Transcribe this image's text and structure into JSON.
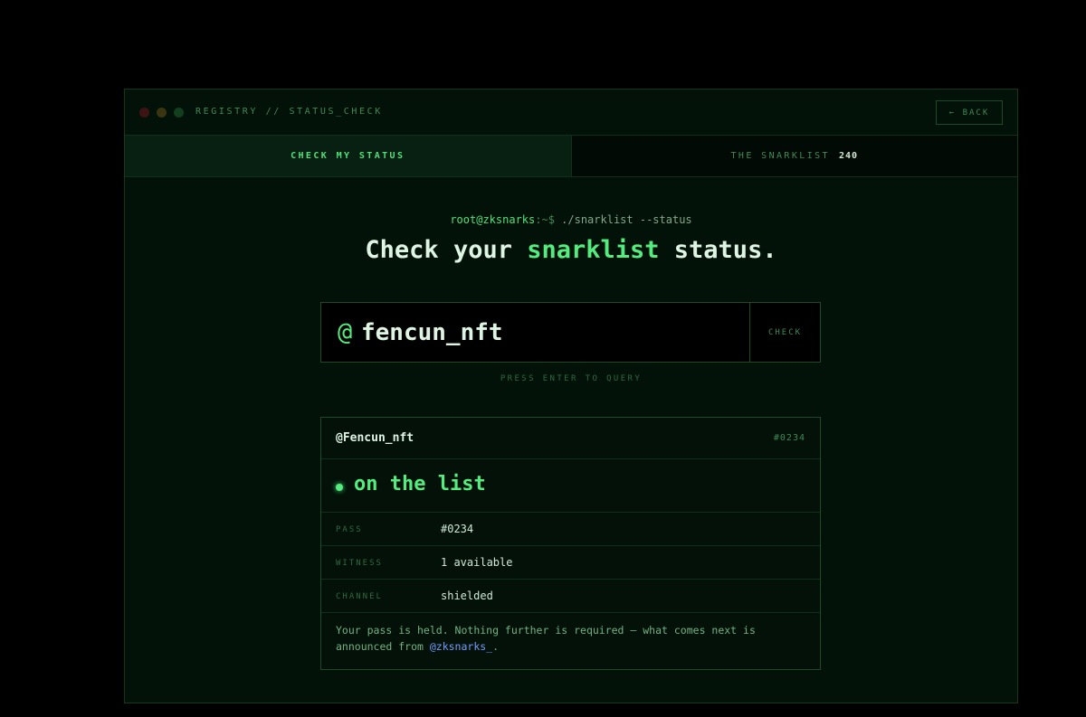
{
  "window": {
    "title": "REGISTRY // STATUS_CHECK",
    "back_label": "← BACK"
  },
  "tabs": [
    {
      "label": "CHECK MY STATUS",
      "active": true
    },
    {
      "label": "THE SNARKLIST",
      "count": "240",
      "active": false
    }
  ],
  "prompt": {
    "user": "root@zksnarks",
    "path": ":~$",
    "command": " ./snarklist --status"
  },
  "heading": {
    "before": "Check your ",
    "accent": "snarklist",
    "after": " status."
  },
  "search": {
    "prefix": "@",
    "value": "fencun_nft",
    "button_label": "CHECK",
    "hint": "PRESS ENTER TO QUERY"
  },
  "result": {
    "handle": "@Fencun_nft",
    "id": "#0234",
    "status": "on the list",
    "rows": [
      {
        "label": "PASS",
        "value": "#0234"
      },
      {
        "label": "WITNESS",
        "value": "1 available"
      },
      {
        "label": "CHANNEL",
        "value": "shielded"
      }
    ],
    "note_text": "Your pass is held. Nothing further is required — what comes next is announced from ",
    "note_link": "@zksnarks_",
    "note_end": "."
  },
  "colors": {
    "accent": "#55ec7f",
    "background": "#031208",
    "link": "#6f9dff"
  }
}
